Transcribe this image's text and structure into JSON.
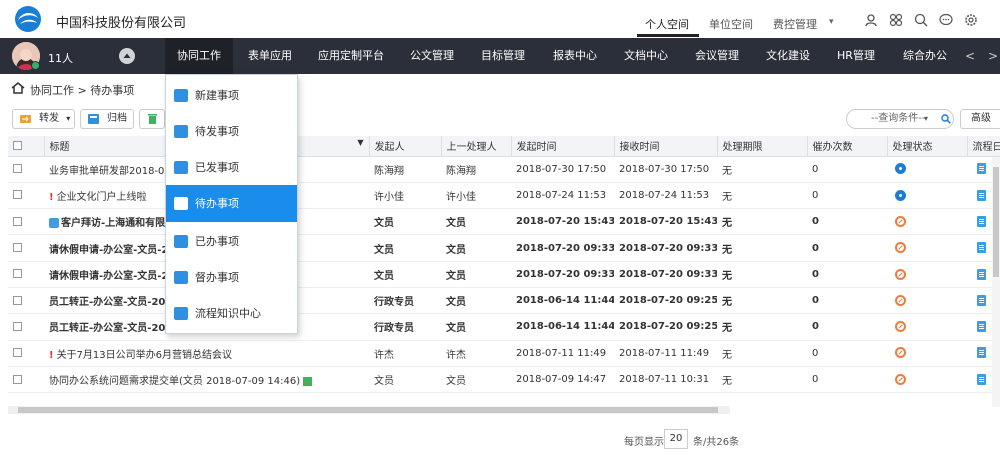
{
  "header": {
    "company": "中国科技股份有限公司",
    "top_tabs": [
      {
        "label": "个人空间",
        "active": true
      },
      {
        "label": "单位空间",
        "active": false
      },
      {
        "label": "费控管理",
        "active": false
      }
    ],
    "top_icons": [
      "user-icon",
      "apps-icon",
      "search-icon",
      "chat-icon",
      "settings-icon"
    ]
  },
  "nav": {
    "user_count": "11人",
    "items": [
      {
        "label": "协同工作",
        "active": true
      },
      {
        "label": "表单应用"
      },
      {
        "label": "应用定制平台"
      },
      {
        "label": "公文管理"
      },
      {
        "label": "目标管理"
      },
      {
        "label": "报表中心"
      },
      {
        "label": "文档中心"
      },
      {
        "label": "会议管理"
      },
      {
        "label": "文化建设"
      },
      {
        "label": "HR管理"
      },
      {
        "label": "综合办公"
      }
    ],
    "prev_arrow": "<",
    "next_arrow": ">"
  },
  "breadcrumb": "协同工作 > 待办事项",
  "toolbar": {
    "forward_label": "转发",
    "archive_label": "归档",
    "query_placeholder": "--查询条件--",
    "advanced_label": "高级"
  },
  "dropdown": {
    "items": [
      {
        "label": "新建事项",
        "active": false
      },
      {
        "label": "待发事项",
        "active": false
      },
      {
        "label": "已发事项",
        "active": false
      },
      {
        "label": "待办事项",
        "active": true
      },
      {
        "label": "已办事项",
        "active": false
      },
      {
        "label": "督办事项",
        "active": false
      },
      {
        "label": "流程知识中心",
        "active": false
      }
    ]
  },
  "table": {
    "columns": [
      "标题",
      "发起人",
      "上一处理人",
      "发起时间",
      "接收时间",
      "处理期限",
      "催办次数",
      "处理状态",
      "流程日志"
    ],
    "rows": [
      {
        "title": "业务审批单研发部2018-07-",
        "urgent": false,
        "bold": false,
        "initiator": "陈海翔",
        "prev": "陈海翔",
        "start": "2018-07-30 17:50",
        "recv": "2018-07-30 17:50",
        "deadline": "无",
        "urge": "0",
        "status": "eye"
      },
      {
        "title": "企业文化门户上线啦",
        "urgent": true,
        "bold": false,
        "initiator": "许小佳",
        "prev": "许小佳",
        "start": "2018-07-24 11:53",
        "recv": "2018-07-24 11:53",
        "deadline": "无",
        "urge": "0",
        "status": "eye"
      },
      {
        "title": "客户拜访-上海通和有限公",
        "urgent": false,
        "bold": true,
        "customer": true,
        "initiator": "文员",
        "prev": "文员",
        "start": "2018-07-20 15:43",
        "recv": "2018-07-20 15:43",
        "deadline": "无",
        "urge": "0",
        "status": "stop"
      },
      {
        "title": "请休假申请-办公室-文员-20",
        "urgent": false,
        "bold": true,
        "initiator": "文员",
        "prev": "文员",
        "start": "2018-07-20 09:33",
        "recv": "2018-07-20 09:33",
        "deadline": "无",
        "urge": "0",
        "status": "stop"
      },
      {
        "title": "请休假申请-办公室-文员-20",
        "urgent": false,
        "bold": true,
        "initiator": "文员",
        "prev": "文员",
        "start": "2018-07-20 09:33",
        "recv": "2018-07-20 09:33",
        "deadline": "无",
        "urge": "0",
        "status": "stop"
      },
      {
        "title": "员工转正-办公室-文员-201",
        "urgent": false,
        "bold": true,
        "initiator": "行政专员",
        "prev": "文员",
        "start": "2018-06-14 11:44",
        "recv": "2018-07-20 09:25",
        "deadline": "无",
        "urge": "0",
        "status": "stop"
      },
      {
        "title": "员工转正-办公室-文员-201",
        "urgent": false,
        "bold": true,
        "initiator": "行政专员",
        "prev": "文员",
        "start": "2018-06-14 11:44",
        "recv": "2018-07-20 09:25",
        "deadline": "无",
        "urge": "0",
        "status": "stop"
      },
      {
        "title": "关于7月13日公司举办6月营销总结会议",
        "urgent": true,
        "bold": false,
        "initiator": "许杰",
        "prev": "许杰",
        "start": "2018-07-11 11:49",
        "recv": "2018-07-11 11:49",
        "deadline": "无",
        "urge": "0",
        "status": "stop"
      },
      {
        "title": "协同办公系统问题需求提交单(文员 2018-07-09 14:46)",
        "urgent": false,
        "bold": false,
        "green": true,
        "initiator": "文员",
        "prev": "文员",
        "start": "2018-07-09 14:47",
        "recv": "2018-07-11 10:31",
        "deadline": "无",
        "urge": "0",
        "status": "stop"
      }
    ]
  },
  "pager": {
    "per_page_label": "每页显示",
    "per_page": "20",
    "total_label": "条/共26条"
  },
  "colors": {
    "nav_bg": "#2b2f3a",
    "accent": "#1a8ceb",
    "urgent": "#e8312f",
    "status_eye": "#1a7ed6",
    "status_stop": "#f07b3f"
  }
}
